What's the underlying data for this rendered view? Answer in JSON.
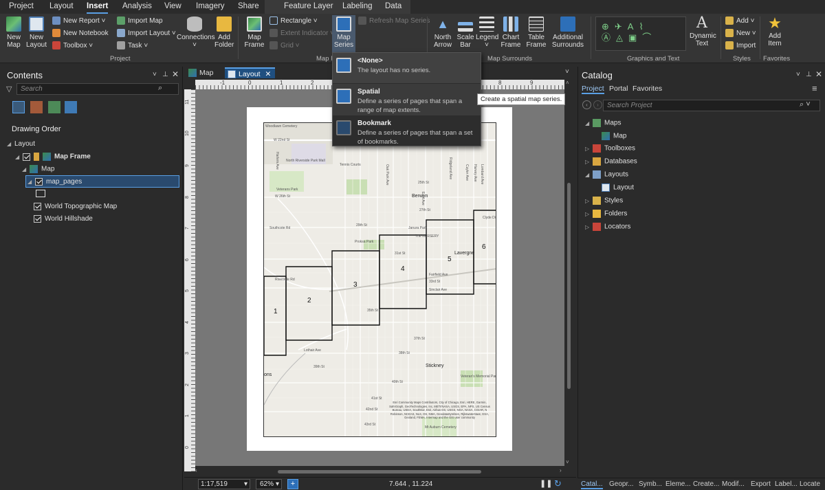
{
  "menu_tabs": [
    "Project",
    "Layout",
    "Insert",
    "Analysis",
    "View",
    "Imagery",
    "Share",
    "Feature Layer",
    "Labeling",
    "Data"
  ],
  "ribbon": {
    "project": {
      "new_map": "New\nMap",
      "new_layout": "New\nLayout",
      "new_report": "New Report",
      "new_notebook": "New Notebook",
      "toolbox": "Toolbox",
      "import_map": "Import Map",
      "import_layout": "Import Layout",
      "task": "Task",
      "connections": "Connections",
      "add_folder": "Add\nFolder",
      "label": "Project"
    },
    "map_frame": {
      "map_frame": "Map\nFrame",
      "rectangle": "Rectangle",
      "extent_indicator": "Extent Indicator",
      "grid": "Grid",
      "map_series": "Map\nSeries",
      "refresh_map_series": "Refresh Map Series",
      "label": "Map F"
    },
    "map_surrounds": {
      "north_arrow": "North\nArrow",
      "scale_bar": "Scale\nBar",
      "legend": "Legend",
      "chart_frame": "Chart\nFrame",
      "table_frame": "Table\nFrame",
      "additional_surrounds": "Additional\nSurrounds",
      "label": "Map Surrounds"
    },
    "graphics": {
      "dynamic_text": "Dynamic\nText",
      "label": "Graphics and Text"
    },
    "styles": {
      "add": "Add",
      "new": "New",
      "import": "Import",
      "label": "Styles"
    },
    "favorites": {
      "add_item": "Add\nItem",
      "label": "Favorites"
    }
  },
  "map_series_menu": {
    "items": [
      {
        "title": "<None>",
        "desc": "The layout has no series."
      },
      {
        "title": "Spatial",
        "desc": "Define a series of pages that span a range of map extents."
      },
      {
        "title": "Bookmark",
        "desc": "Define a series of pages that span a set of bookmarks."
      }
    ],
    "tooltip": "Create a spatial map series."
  },
  "contents": {
    "title": "Contents",
    "search_placeholder": "Search",
    "heading": "Drawing Order",
    "layers": [
      "Layout",
      "Map Frame",
      "Map",
      "map_pages",
      "World Topographic Map",
      "World Hillshade"
    ]
  },
  "doc_tabs": [
    "Map",
    "Layout"
  ],
  "map": {
    "page_numbers": [
      "1",
      "2",
      "3",
      "4",
      "5",
      "6"
    ],
    "labels": [
      "Berwyn",
      "Lavergne",
      "Stickney",
      "Veterans Park",
      "Proksa Park",
      "North Riverside Park Mall",
      "Tennis Courts",
      "W 22nd St",
      "W 26th St",
      "25th St",
      "27th St",
      "29th St",
      "31st St",
      "33rd St",
      "35th St",
      "37th St",
      "38th St",
      "39th St",
      "40th St",
      "41st St",
      "42nd St",
      "43rd St",
      "Woodlawn Cemetery",
      "Clyde District",
      "Veteran's Memorial Park",
      "Mt Auburn Cemetery",
      "Riverside Rd",
      "Southcote Rd",
      "Fairfield Ave",
      "Sinclair Ave",
      "The NURSERY",
      "Janura Park",
      "Lothair Ave",
      "ons",
      "Harlem Ave",
      "Oak Park Ave",
      "East Ave",
      "Ridgeland Ave",
      "Cuyler Ave",
      "Harvey Ave",
      "Lombard Ave"
    ],
    "attribution": "Esri Community Maps Contributors, City of Chicago, Esri, HERE, Garmin, SafeGraph, GeoTechnologies, Inc, METI/NASA, USGS, EPA, NPS, US Census Bureau, USDA, SouthEar, Esri, Airbus DS, USGS, NGA, NASA, CGIAR, N Robinson, NCEAS, NLS, OS, NMA, Geodatastyrelsen, Rijkswaterstaat, GSA, Geoland, FEMA, Intermap and the GIS user community"
  },
  "ruler_h": [
    "-1",
    "0",
    "1",
    "2",
    "8",
    "9"
  ],
  "ruler_v": [
    "11",
    "10",
    "9",
    "8",
    "7",
    "6",
    "5",
    "4",
    "3",
    "2",
    "1",
    "0"
  ],
  "status": {
    "scale": "1:17,519",
    "zoom": "62%",
    "coords": "7.644 , 11.224"
  },
  "catalog": {
    "title": "Catalog",
    "tabs": [
      "Project",
      "Portal",
      "Favorites"
    ],
    "search_placeholder": "Search Project",
    "items": [
      "Maps",
      "Map",
      "Toolboxes",
      "Databases",
      "Layouts",
      "Layout",
      "Styles",
      "Folders",
      "Locators"
    ],
    "bottom_tabs": [
      "Catal...",
      "Geopr...",
      "Symb...",
      "Eleme...",
      "Create...",
      "Modif...",
      "Export",
      "Label...",
      "Locate"
    ]
  },
  "colors": {
    "accent": "#5aa0e6",
    "selected_row": "#2a4a6e",
    "canvas": "#777777"
  }
}
